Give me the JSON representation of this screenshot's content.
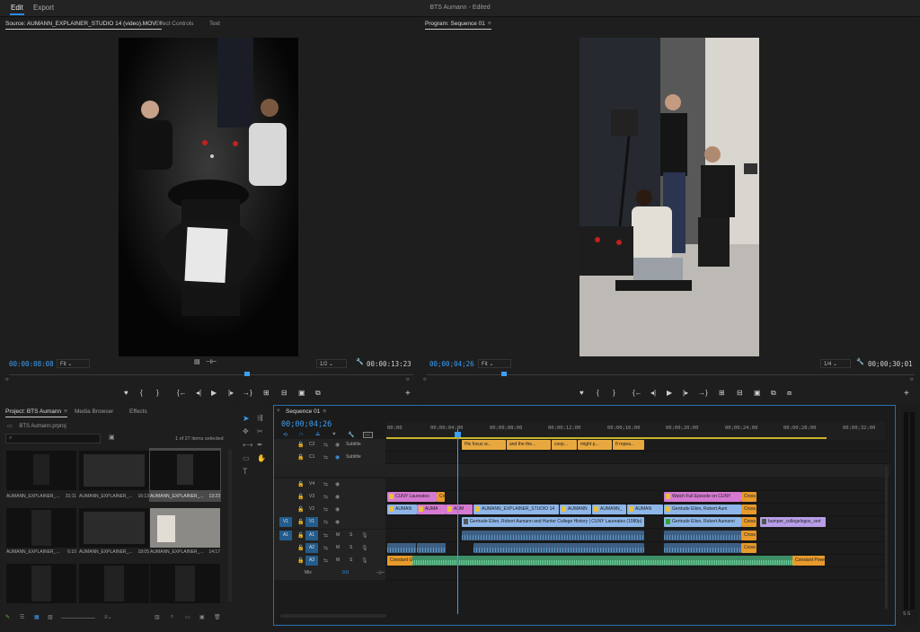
{
  "topbar": {
    "tab_edit": "Edit",
    "tab_export": "Export",
    "title": "BTS Aumann",
    "edited": "Edited"
  },
  "source": {
    "tabs": [
      "Source: AUMANN_EXPLAINER_STUDIO 14 (video).MOV",
      "Effect Controls",
      "Text"
    ],
    "timecode": "00:00:08:08",
    "fit": "Fit",
    "res": "1/2",
    "duration": "00:00:13:23"
  },
  "program": {
    "tab": "Program: Sequence 01",
    "timecode": "00;00;04;26",
    "fit": "Fit",
    "res": "1/4",
    "duration": "00;00;30;01"
  },
  "project": {
    "tabs": [
      "Project: BTS Aumann",
      "Media Browser",
      "Effects"
    ],
    "file": "BTS Aumann.prproj",
    "selection": "1 of 27 items selected",
    "items": [
      {
        "name": "AUMANN_EXPLAINER_...",
        "dur": "31:11"
      },
      {
        "name": "AUMANN_EXPLAINER_...",
        "dur": "16:13"
      },
      {
        "name": "AUMANN_EXPLAINER_...",
        "dur": "13:23"
      },
      {
        "name": "AUMANN_EXPLAINER_...",
        "dur": "6:10"
      },
      {
        "name": "AUMANN_EXPLAINER_...",
        "dur": "18:05"
      },
      {
        "name": "AUMANN_EXPLAINER_...",
        "dur": "14:17"
      }
    ]
  },
  "timeline": {
    "tab": "Sequence 01",
    "timecode": "00;00;04;26",
    "ruler": [
      "00;00",
      "00;00;04;00",
      "00;00;08;00",
      "00;00;12;00",
      "00;00;16;00",
      "00;00;20;00",
      "00;00;24;00",
      "00;00;28;00",
      "00;00;32;00"
    ],
    "tracks": {
      "c2": "C2",
      "c1": "C1",
      "subtitle": "Subtitle",
      "v4": "V4",
      "v3": "V3",
      "v2": "V2",
      "v1": "V1",
      "a1": "A1",
      "a2": "A2",
      "a3": "A3",
      "mix": "Mix",
      "mix_val": "0.0",
      "m": "M",
      "s": "S"
    },
    "subtitles": [
      "His focus w...",
      "and the the...",
      "coop...",
      "might p...",
      "If repea..."
    ],
    "v3": [
      "CUNY Laureates",
      "Cro",
      "Watch Full Episode on CUNY",
      "Cross"
    ],
    "v2": [
      "AUMAN",
      "AUMA",
      "AUM",
      "AUMANN_EXPLAINER_STUDIO 14",
      "AUMANN",
      "AUMANN_",
      "AUMAN",
      "Gertrude Elion, Robert Aum",
      "Cross"
    ],
    "v1": [
      "Gertrude Elion, Robert Aumann and Hunter College History | CUNY Laureates (1080p)",
      "Gertrude Elion, Robert Aumann",
      "Cross",
      "bumper_collegelogos_vert"
    ],
    "a1": [
      "Cross"
    ],
    "a2": [
      "Cross"
    ],
    "a3": [
      "Constant Gai",
      "Constant Power"
    ],
    "meter": "S S"
  }
}
